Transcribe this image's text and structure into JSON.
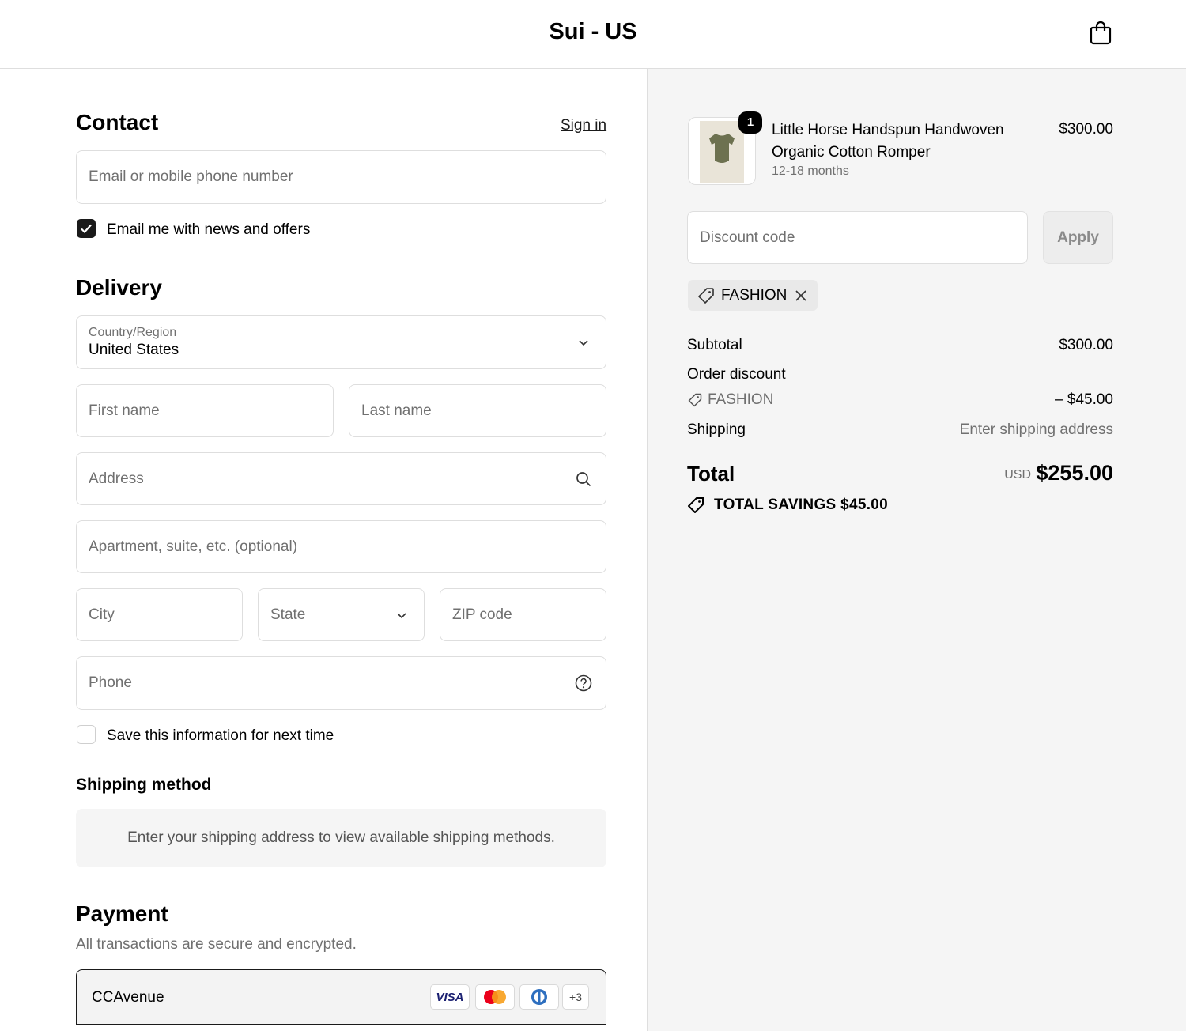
{
  "header": {
    "store_name": "Sui - US"
  },
  "contact": {
    "title": "Contact",
    "sign_in": "Sign in",
    "email_placeholder": "Email or mobile phone number",
    "newsletter_label": "Email me with news and offers"
  },
  "delivery": {
    "title": "Delivery",
    "country_label": "Country/Region",
    "country_value": "United States",
    "first_name": "First name",
    "last_name": "Last name",
    "address": "Address",
    "apartment": "Apartment, suite, etc. (optional)",
    "city": "City",
    "state": "State",
    "zip": "ZIP code",
    "phone": "Phone",
    "save_info_label": "Save this information for next time"
  },
  "shipping": {
    "title": "Shipping method",
    "notice": "Enter your shipping address to view available shipping methods."
  },
  "payment": {
    "title": "Payment",
    "subtitle": "All transactions are secure and encrypted.",
    "method": "CCAvenue",
    "card_visa": "VISA",
    "more_cards": "+3"
  },
  "order": {
    "quantity": "1",
    "product_name": "Little Horse Handspun Handwoven Organic Cotton Romper",
    "variant": "12-18 months",
    "price": "$300.00",
    "discount_placeholder": "Discount code",
    "apply_label": "Apply",
    "applied_code": "FASHION",
    "subtotal_label": "Subtotal",
    "subtotal_value": "$300.00",
    "order_discount_label": "Order discount",
    "discount_code": "FASHION",
    "discount_value": "– $45.00",
    "shipping_label": "Shipping",
    "shipping_value": "Enter shipping address",
    "total_label": "Total",
    "currency": "USD",
    "total_value": "$255.00",
    "savings": "TOTAL SAVINGS  $45.00"
  }
}
